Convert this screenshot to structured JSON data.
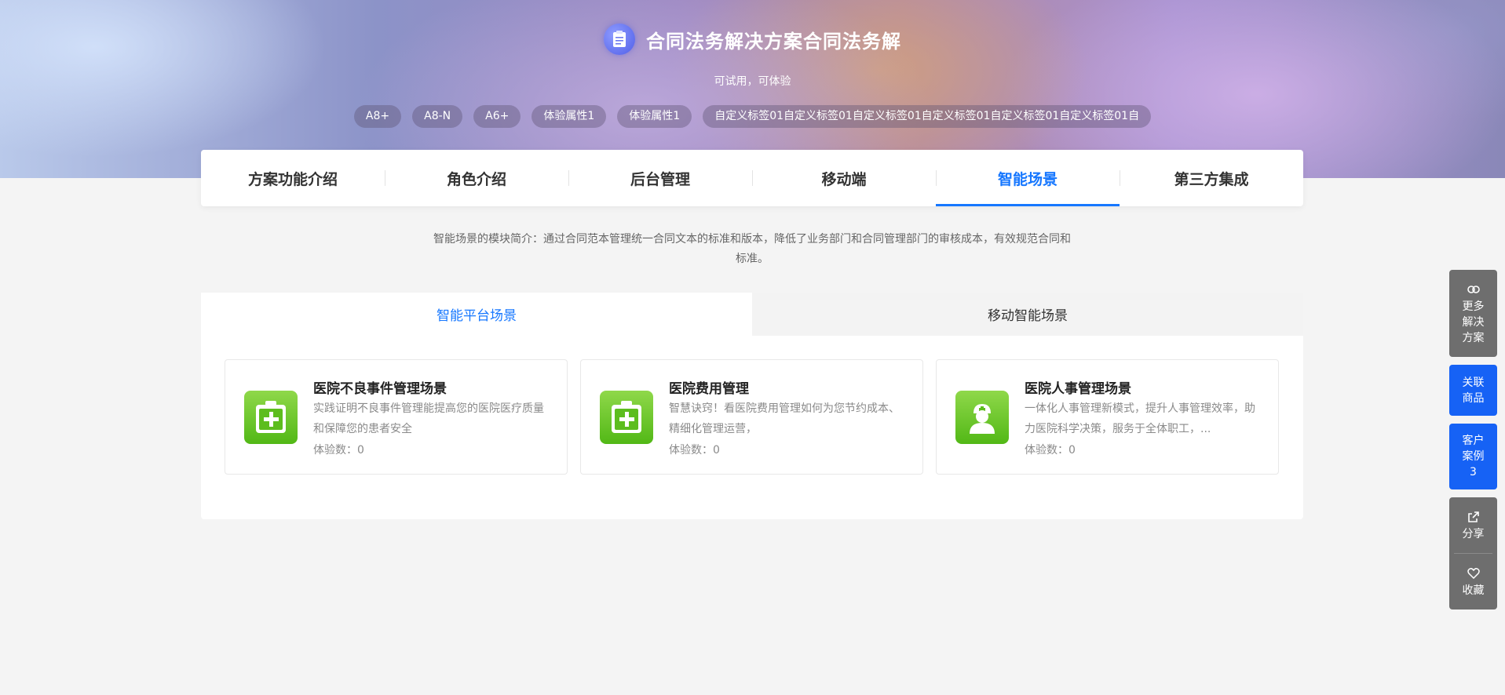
{
  "hero": {
    "title": "合同法务解决方案合同法务解",
    "subtitle": "可试用，可体验",
    "tags": [
      "A8+",
      "A8-N",
      "A6+",
      "体验属性1",
      "体验属性1",
      "自定义标签01自定义标签01自定义标签01自定义标签01自定义标签01自定义标签01自"
    ]
  },
  "nav": {
    "tabs": [
      "方案功能介绍",
      "角色介绍",
      "后台管理",
      "移动端",
      "智能场景",
      "第三方集成"
    ],
    "active": "智能场景"
  },
  "description": {
    "line1": "智能场景的模块简介：通过合同范本管理统一合同文本的标准和版本，降低了业务部门和合同管理部门的审核成本，有效规范合同和",
    "line2": "标准。"
  },
  "scene_tabs": {
    "tabs": [
      "智能平台场景",
      "移动智能场景"
    ],
    "active": "智能平台场景"
  },
  "cards": [
    {
      "icon": "medical-kit-icon",
      "title": "医院不良事件管理场景",
      "desc": "实践证明不良事件管理能提高您的医院医疗质量和保障您的患者安全",
      "count_label": "体验数：0"
    },
    {
      "icon": "medical-kit-icon",
      "title": "医院费用管理",
      "desc": "智慧诀窍！看医院费用管理如何为您节约成本、精细化管理运营，",
      "count_label": "体验数：0"
    },
    {
      "icon": "doctor-user-icon",
      "title": "医院人事管理场景",
      "desc": "一体化人事管理新模式，提升人事管理效率，助力医院科学决策，服务于全体职工，...",
      "count_label": "体验数：0"
    }
  ],
  "float_bar": {
    "more": "更多解决方案",
    "related": "关联商品",
    "cases": "客户案例",
    "cases_count": "3",
    "share": "分享",
    "favorite": "收藏"
  },
  "colors": {
    "accent": "#1677ff",
    "float_blue": "#1662f5",
    "float_gray": "#6e6e6e",
    "icon_green": "#52b816"
  }
}
